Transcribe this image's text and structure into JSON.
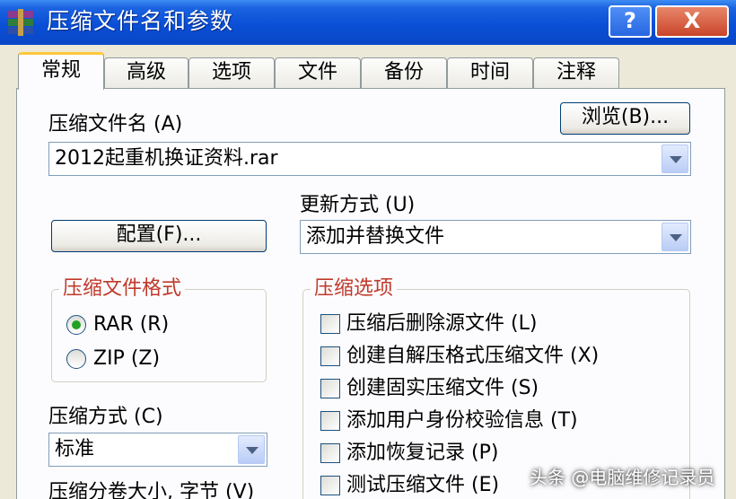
{
  "window": {
    "title": "压缩文件名和参数",
    "help_label": "?",
    "close_label": "X"
  },
  "tabs": [
    {
      "label": "常规",
      "active": true
    },
    {
      "label": "高级"
    },
    {
      "label": "选项"
    },
    {
      "label": "文件"
    },
    {
      "label": "备份"
    },
    {
      "label": "时间"
    },
    {
      "label": "注释"
    }
  ],
  "archive_name": {
    "label": "压缩文件名 (A)",
    "value": "2012起重机换证资料.rar",
    "browse_label": "浏览(B)..."
  },
  "profiles": {
    "label": "配置(F)..."
  },
  "update_mode": {
    "label": "更新方式 (U)",
    "value": "添加并替换文件"
  },
  "archive_format": {
    "title": "压缩文件格式",
    "options": [
      {
        "label": "RAR (R)",
        "selected": true
      },
      {
        "label": "ZIP (Z)",
        "selected": false
      }
    ]
  },
  "compression_method": {
    "label": "压缩方式 (C)",
    "value": "标准"
  },
  "split_volume": {
    "label": "压缩分卷大小, 字节 (V)"
  },
  "archive_options": {
    "title": "压缩选项",
    "items": [
      {
        "label": "压缩后删除源文件 (L)",
        "checked": false
      },
      {
        "label": "创建自解压格式压缩文件 (X)",
        "checked": false
      },
      {
        "label": "创建固实压缩文件 (S)",
        "checked": false
      },
      {
        "label": "添加用户身份校验信息 (T)",
        "checked": false
      },
      {
        "label": "添加恢复记录 (P)",
        "checked": false
      },
      {
        "label": "测试压缩文件 (E)",
        "checked": false
      }
    ]
  },
  "watermark": "头条 @电脑维修记录员"
}
